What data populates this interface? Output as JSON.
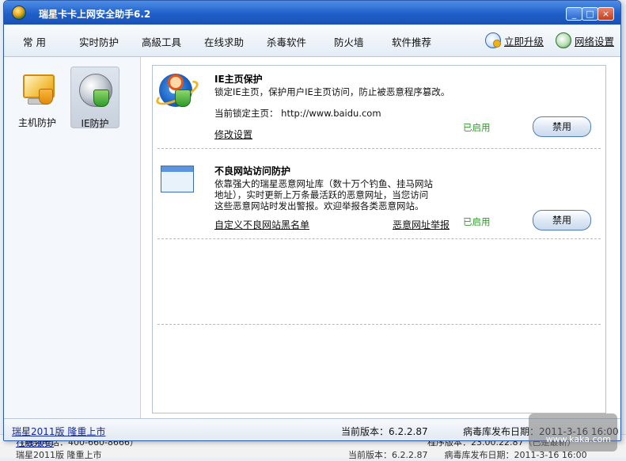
{
  "window": {
    "title": "瑞星卡卡上网安全助手6.2",
    "min": "_",
    "max": "□",
    "close": "×"
  },
  "menu": {
    "items": [
      "常 用",
      "实时防护",
      "高級工具",
      "在线求助",
      "杀毒软件",
      "防火墙",
      "软件推荐"
    ],
    "upgrade_label": "立即升级",
    "netset_label": "网络设置"
  },
  "sidebar": {
    "items": [
      {
        "label": "主机防护",
        "icon": "pc-shield-icon"
      },
      {
        "label": "IE防护",
        "icon": "globe-shield-icon",
        "selected": true
      }
    ]
  },
  "ie_home": {
    "title": "IE主页保护",
    "desc": "锁定IE主页，保护用户IE主页访问，防止被恶意程序篡改。",
    "current_label": "当前锁定主页：",
    "current_url": "http://www.baidu.com",
    "modify_link": "修改设置",
    "status": "已启用",
    "button": "禁用"
  },
  "bad_site": {
    "title": "不良网站访问防护",
    "desc_lines": [
      "依靠强大的瑞星恶意网址库（数十万个钓鱼、挂马网站",
      "地址），实时更新上万条最活跃的恶意网址，当您访问",
      "这些恶意网站时发出警报。欢迎举报各类恶意网站。"
    ],
    "custom_link": "自定义不良网站黑名单",
    "report_link": "恶意网址举报",
    "status": "已启用",
    "button": "禁用"
  },
  "statusbar": {
    "promo": "瑞星2011版 隆重上市",
    "version": "当前版本：6.2.2.87",
    "db_date": "病毒库发布日期：2011-3-16 16:00"
  },
  "background": {
    "online_service": "在线服务",
    "phone": "（服务电话：400-660-8666）",
    "prog_version": "程序版本：23.00.22.87（已是最新）",
    "promo2": "瑞星2011版 隆重上市",
    "version2": "当前版本：6.2.2.87",
    "date2": "病毒库发布日期：2011-3-16 16:00"
  },
  "watermark": "www.kaka.com",
  "colors": {
    "title_blue": "#1f5fc9",
    "enabled_green": "#2e9b2a",
    "link_blue": "#13279d"
  }
}
